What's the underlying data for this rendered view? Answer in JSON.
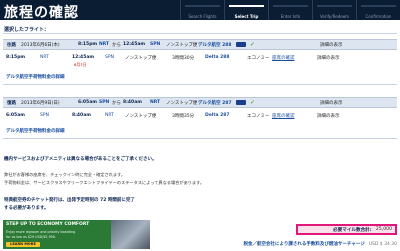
{
  "header": {
    "title": "旅程の確認",
    "steps": [
      {
        "label": "Search Flights",
        "active": false
      },
      {
        "label": "Select Trip",
        "active": true
      },
      {
        "label": "Enter Info",
        "active": false
      },
      {
        "label": "Verify/Redeem",
        "active": false
      },
      {
        "label": "Confirmation",
        "active": false
      }
    ]
  },
  "section_title": "選択したフライト：",
  "outbound": {
    "header": {
      "label": "往路",
      "date": "2013年6月6日(木)",
      "depart_time": "8:15pm",
      "depart_airport": "NRT",
      "from_word": "から",
      "arrive_time": "12:45am",
      "arrive_airport": "SPN",
      "stops": "ノンストップ便",
      "flight": "デルタ航空 288",
      "details_label": "詳細の表示"
    },
    "segment": {
      "depart_time": "8:15pm",
      "depart_airport": "NRT",
      "arrive_time": "12:45am",
      "arrive_date_note": "6月7日",
      "arrive_airport": "SPN",
      "stops": "ノンストップ便",
      "duration": "3時間30分",
      "flight": "Delta 288",
      "cabin": "エコノミー",
      "seat_link": "座席の確認",
      "details_label": "詳細の表示"
    },
    "baggage_link": "デルタ航空手荷物料金の詳細"
  },
  "return": {
    "header": {
      "label": "復路",
      "date": "2013年6月9日(日)",
      "depart_time": "6:05am",
      "depart_airport": "SPN",
      "from_word": "から",
      "arrive_time": "8:40am",
      "arrive_airport": "NRT",
      "stops": "ノンストップ便",
      "flight": "デルタ航空 287",
      "details_label": "詳細の表示"
    },
    "segment": {
      "depart_time": "6:05am",
      "depart_airport": "SPN",
      "arrive_time": "8:40am",
      "arrive_airport": "NRT",
      "stops": "ノンストップ便",
      "duration": "3時間35分",
      "flight": "Delta 287",
      "cabin": "エコノミー",
      "seat_link": "座席の確認",
      "details_label": "詳細の表示"
    },
    "baggage_link": "デルタ航空手荷物料金の詳細"
  },
  "notes": {
    "amenities": "機内サービスおよびアメニティは異なる場合があることをご了承ください。",
    "checkin_line1": "弊社がお客様の座席を、チェックイン時に完全・確定されます。",
    "checkin_line2": "手荷物料金は、サービスクラスやフリークエントフライヤーのステータスによって異なる場合があります。",
    "ticketing_line1": "特典航空券のチケット発行は、出発予定時刻の 72 時間前に完了",
    "ticketing_line2": "する必要があります。"
  },
  "banner": {
    "title": "STEP UP TO ECONOMY COMFORT",
    "subtitle1": "Enjoy more legroom and priority boarding",
    "subtitle2": "for as low as $29 USD/¥2,990.",
    "button_label": "LEARN MORE"
  },
  "miles": {
    "label": "必要マイル数合計:",
    "value": "25,000"
  },
  "footer": {
    "link": "税金／航空会社により課される手数料及び燃油サーチャージ",
    "price": "USD $ 34.30"
  }
}
